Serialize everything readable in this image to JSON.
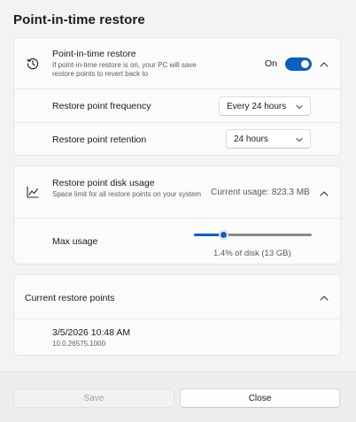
{
  "page": {
    "title": "Point-in-time restore"
  },
  "restore_section": {
    "title": "Point-in-time restore",
    "description": "If point-in-time restore is on, your PC will save restore points to revert back to",
    "toggle_label": "On",
    "toggle_state": true,
    "icon": "history-clock-icon",
    "frequency": {
      "label": "Restore point frequency",
      "value": "Every 24 hours"
    },
    "retention": {
      "label": "Restore point retention",
      "value": "24 hours"
    }
  },
  "disk_section": {
    "title": "Restore point disk usage",
    "description": "Space limit for all restore points on your system",
    "current_usage": "Current usage: 823.3 MB",
    "icon": "line-chart-icon",
    "max_usage": {
      "label": "Max usage",
      "value_text": "1.4% of disk (13 GB)",
      "slider_fraction": 0.25
    }
  },
  "points_section": {
    "title": "Current restore points",
    "points": [
      {
        "datetime": "3/5/2026 10:48 AM",
        "version": "10.0.26575.1000"
      }
    ]
  },
  "footer": {
    "save_label": "Save",
    "close_label": "Close"
  },
  "colors": {
    "accent": "#0a5fbf",
    "background": "#f3f3f3",
    "card": "#fbfbfb"
  }
}
